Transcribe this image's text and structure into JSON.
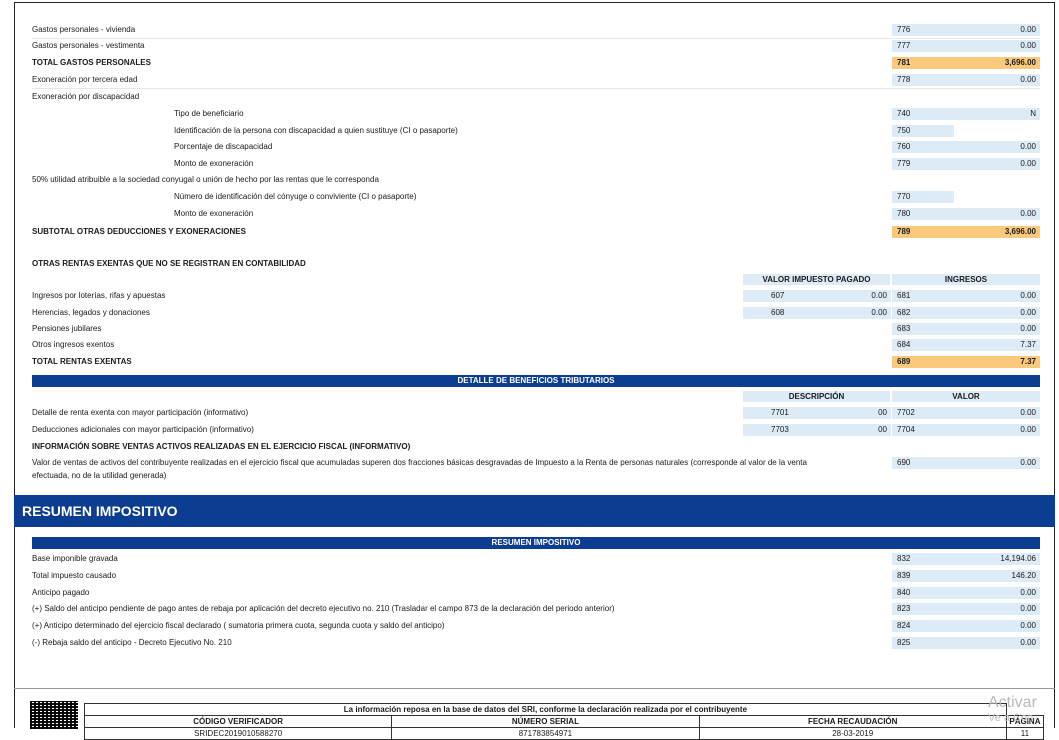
{
  "rows_top": [
    {
      "label": "Gastos personales - vivienda",
      "code": "776",
      "value": "0.00"
    },
    {
      "label": "Gastos personales - vestimenta",
      "code": "777",
      "value": "0.00"
    }
  ],
  "total_gastos": {
    "label": "TOTAL GASTOS PERSONALES",
    "code": "781",
    "value": "3,696.00"
  },
  "exoneracion_edad": {
    "label": "Exoneración por tercera edad",
    "code": "778",
    "value": "0.00"
  },
  "exoneracion_discap": {
    "label": "Exoneración por discapacidad"
  },
  "discap_rows": [
    {
      "label": "Tipo de beneficiario",
      "code": "740",
      "value": "N"
    },
    {
      "label": "Identificación de la persona con discapacidad a quien sustituye (CI o pasaporte)",
      "code": "750",
      "value": ""
    },
    {
      "label": "Porcentaje de discapacidad",
      "code": "760",
      "value": "0.00"
    },
    {
      "label": "Monto de exoneración",
      "code": "779",
      "value": "0.00"
    }
  ],
  "utilidad": {
    "label": "50% utilidad atribuible a la sociedad conyugal o unión de hecho por las rentas que le corresponda"
  },
  "utilidad_rows": [
    {
      "label": "Número de identificación del cónyuge o conviviente (CI o pasaporte)",
      "code": "770",
      "value": ""
    },
    {
      "label": "Monto de exoneración",
      "code": "780",
      "value": "0.00"
    }
  ],
  "subtotal": {
    "label": "SUBTOTAL OTRAS DEDUCCIONES Y EXONERACIONES",
    "code": "789",
    "value": "3,696.00"
  },
  "otras_rentas": {
    "title": "OTRAS RENTAS EXENTAS QUE NO SE REGISTRAN EN CONTABILIDAD",
    "col1": "VALOR IMPUESTO PAGADO",
    "col2": "INGRESOS",
    "rows": [
      {
        "label": "Ingresos por loterías, rifas y apuestas",
        "c1": "607",
        "v1": "0.00",
        "c2": "681",
        "v2": "0.00"
      },
      {
        "label": "Herencias, legados y donaciones",
        "c1": "608",
        "v1": "0.00",
        "c2": "682",
        "v2": "0.00"
      },
      {
        "label": "Pensiones jubilares",
        "c1": "",
        "v1": "",
        "c2": "683",
        "v2": "0.00"
      },
      {
        "label": "Otros ingresos exentos",
        "c1": "",
        "v1": "",
        "c2": "684",
        "v2": "7.37"
      }
    ],
    "total": {
      "label": "TOTAL RENTAS EXENTAS",
      "code": "689",
      "value": "7.37"
    }
  },
  "beneficios": {
    "header": "DETALLE DE BENEFICIOS TRIBUTARIOS",
    "col1": "DESCRIPCIÓN",
    "col2": "VALOR",
    "rows": [
      {
        "label": "Detalle de renta exenta con mayor participación (informativo)",
        "c1": "7701",
        "v1": "00",
        "c2": "7702",
        "v2": "0.00"
      },
      {
        "label": "Deducciones adicionales con mayor participación (informativo)",
        "c1": "7703",
        "v1": "00",
        "c2": "7704",
        "v2": "0.00"
      }
    ]
  },
  "ventas": {
    "title": "INFORMACIÓN SOBRE VENTAS ACTIVOS REALIZADAS EN EL EJERCICIO FISCAL (INFORMATIVO)",
    "text1": "Valor de ventas de activos del contribuyente realizadas en el ejercicio fiscal que acumuladas superen dos fracciones básicas desgravadas de Impuesto a la Renta de personas naturales (corresponde al valor de la venta",
    "text2": "efectuada, no de la utilidad generada)",
    "code": "690",
    "value": "0.00"
  },
  "resumen": {
    "big_title": "RESUMEN IMPOSITIVO",
    "header": "RESUMEN IMPOSITIVO",
    "rows": [
      {
        "label": "Base imponible gravada",
        "code": "832",
        "value": "14,194.06"
      },
      {
        "label": "Total impuesto causado",
        "code": "839",
        "value": "146.20"
      },
      {
        "label": "Anticipo pagado",
        "code": "840",
        "value": "0.00"
      },
      {
        "label": "(+) Saldo del anticipo pendiente de pago antes de rebaja por aplicación del decreto ejecutivo no. 210 (Trasladar el campo 873 de la declaración del periodo anterior)",
        "code": "823",
        "value": "0.00"
      },
      {
        "label": "(+) Anticipo determinado del ejercicio fiscal declarado ( sumatoria primera cuota, segunda cuota y saldo del anticipo)",
        "code": "824",
        "value": "0.00"
      },
      {
        "label": "(-) Rebaja saldo del anticipo - Decreto Ejecutivo No. 210",
        "code": "825",
        "value": "0.00"
      }
    ]
  },
  "footer": {
    "info": "La información reposa en la base de datos del SRI, conforme la declaración realizada por el contribuyente",
    "h1": "CÓDIGO VERIFICADOR",
    "h2": "NÚMERO SERIAL",
    "h3": "FECHA RECAUDACIÓN",
    "h4": "PÁGINA",
    "v1": "SRIDEC2019010588270",
    "v2": "871783854971",
    "v3": "28-03-2019",
    "v4": "11"
  },
  "watermark": {
    "line1": "Activar",
    "line2": "Ve a Con"
  }
}
